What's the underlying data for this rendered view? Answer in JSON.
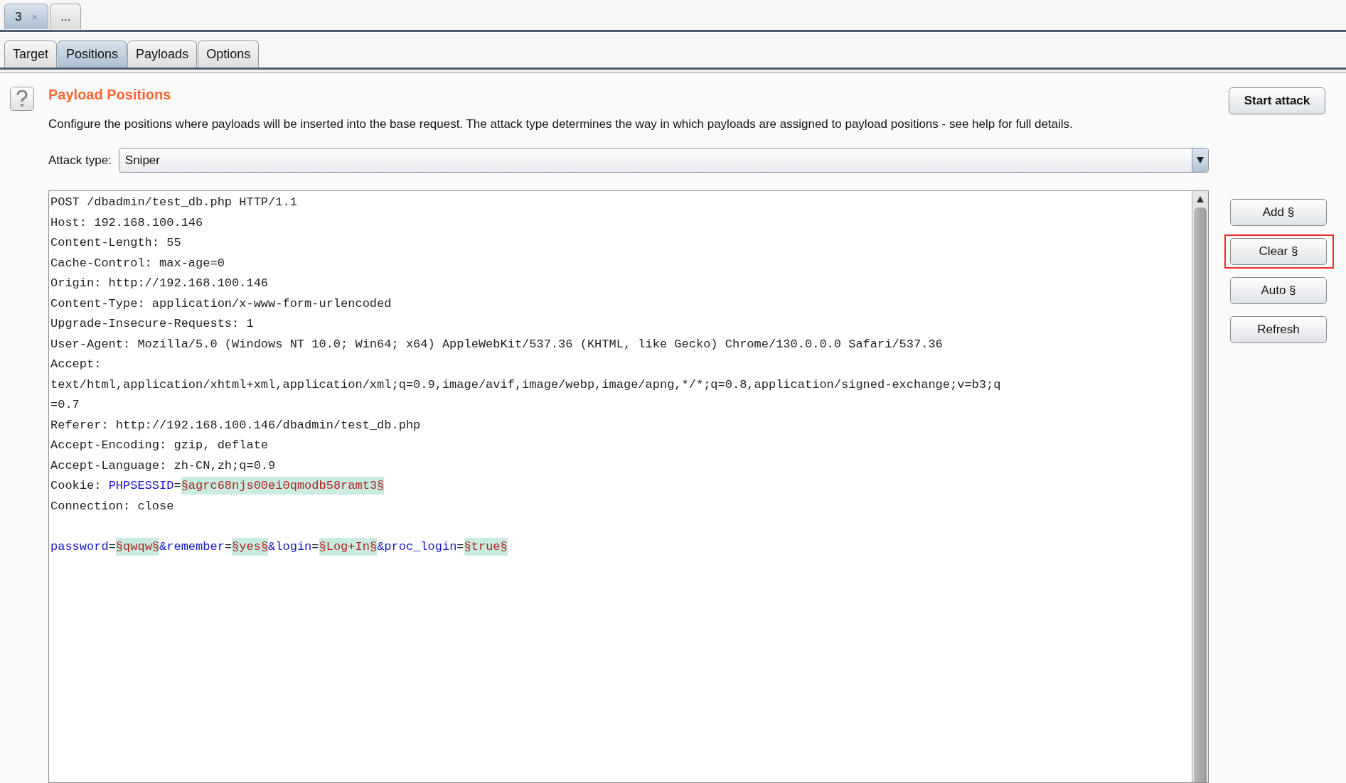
{
  "document_tabs": [
    {
      "label": "3",
      "close": "×",
      "selected": true
    },
    {
      "label": "...",
      "selected": false
    }
  ],
  "tabs": [
    {
      "label": "Target",
      "selected": false
    },
    {
      "label": "Positions",
      "selected": true
    },
    {
      "label": "Payloads",
      "selected": false
    },
    {
      "label": "Options",
      "selected": false
    }
  ],
  "section": {
    "title": "Payload Positions",
    "description": "Configure the positions where payloads will be inserted into the base request. The attack type determines the way in which payloads are assigned to payload positions - see help for full details."
  },
  "attack_type": {
    "label": "Attack type:",
    "value": "Sniper"
  },
  "start_button": "Start attack",
  "request_lines": [
    {
      "kind": "text",
      "segments": [
        {
          "kind": "plain",
          "text": "POST /dbadmin/test_db.php HTTP/1.1"
        }
      ]
    },
    {
      "kind": "text",
      "segments": [
        {
          "kind": "plain",
          "text": "Host: 192.168.100.146"
        }
      ]
    },
    {
      "kind": "text",
      "segments": [
        {
          "kind": "plain",
          "text": "Content-Length: 55"
        }
      ]
    },
    {
      "kind": "text",
      "segments": [
        {
          "kind": "plain",
          "text": "Cache-Control: max-age=0"
        }
      ]
    },
    {
      "kind": "text",
      "segments": [
        {
          "kind": "plain",
          "text": "Origin: http://192.168.100.146"
        }
      ]
    },
    {
      "kind": "text",
      "segments": [
        {
          "kind": "plain",
          "text": "Content-Type: application/x-www-form-urlencoded"
        }
      ]
    },
    {
      "kind": "text",
      "segments": [
        {
          "kind": "plain",
          "text": "Upgrade-Insecure-Requests: 1"
        }
      ]
    },
    {
      "kind": "text",
      "segments": [
        {
          "kind": "plain",
          "text": "User-Agent: Mozilla/5.0 (Windows NT 10.0; Win64; x64) AppleWebKit/537.36 (KHTML, like Gecko) Chrome/130.0.0.0 Safari/537.36"
        }
      ]
    },
    {
      "kind": "text",
      "segments": [
        {
          "kind": "plain",
          "text": "Accept:"
        }
      ]
    },
    {
      "kind": "text",
      "segments": [
        {
          "kind": "plain",
          "text": "text/html,application/xhtml+xml,application/xml;q=0.9,image/avif,image/webp,image/apng,*/*;q=0.8,application/signed-exchange;v=b3;q"
        }
      ]
    },
    {
      "kind": "text",
      "segments": [
        {
          "kind": "plain",
          "text": "=0.7"
        }
      ]
    },
    {
      "kind": "text",
      "segments": [
        {
          "kind": "plain",
          "text": "Referer: http://192.168.100.146/dbadmin/test_db.php"
        }
      ]
    },
    {
      "kind": "text",
      "segments": [
        {
          "kind": "plain",
          "text": "Accept-Encoding: gzip, deflate"
        }
      ]
    },
    {
      "kind": "text",
      "segments": [
        {
          "kind": "plain",
          "text": "Accept-Language: zh-CN,zh;q=0.9"
        }
      ]
    },
    {
      "kind": "text",
      "segments": [
        {
          "kind": "plain",
          "text": "Cookie: "
        },
        {
          "kind": "param",
          "text": "PHPSESSID"
        },
        {
          "kind": "plain",
          "text": "="
        },
        {
          "kind": "payload",
          "text": "§agrc68njs00ei0qmodb58ramt3§"
        }
      ]
    },
    {
      "kind": "text",
      "segments": [
        {
          "kind": "plain",
          "text": "Connection: close"
        }
      ]
    },
    {
      "kind": "blank"
    },
    {
      "kind": "text",
      "segments": [
        {
          "kind": "param",
          "text": "password"
        },
        {
          "kind": "plain",
          "text": "="
        },
        {
          "kind": "payload",
          "text": "§qwqw§"
        },
        {
          "kind": "param",
          "text": "&remember"
        },
        {
          "kind": "plain",
          "text": "="
        },
        {
          "kind": "payload",
          "text": "§yes§"
        },
        {
          "kind": "param",
          "text": "&login"
        },
        {
          "kind": "plain",
          "text": "="
        },
        {
          "kind": "payload",
          "text": "§Log+In§"
        },
        {
          "kind": "param",
          "text": "&proc_login"
        },
        {
          "kind": "plain",
          "text": "="
        },
        {
          "kind": "payload",
          "text": "§true§"
        }
      ]
    }
  ],
  "side_buttons": [
    {
      "label": "Add §",
      "highlighted": false
    },
    {
      "label": "Clear §",
      "highlighted": true
    },
    {
      "label": "Auto §",
      "highlighted": false
    },
    {
      "label": "Refresh",
      "highlighted": false
    }
  ]
}
